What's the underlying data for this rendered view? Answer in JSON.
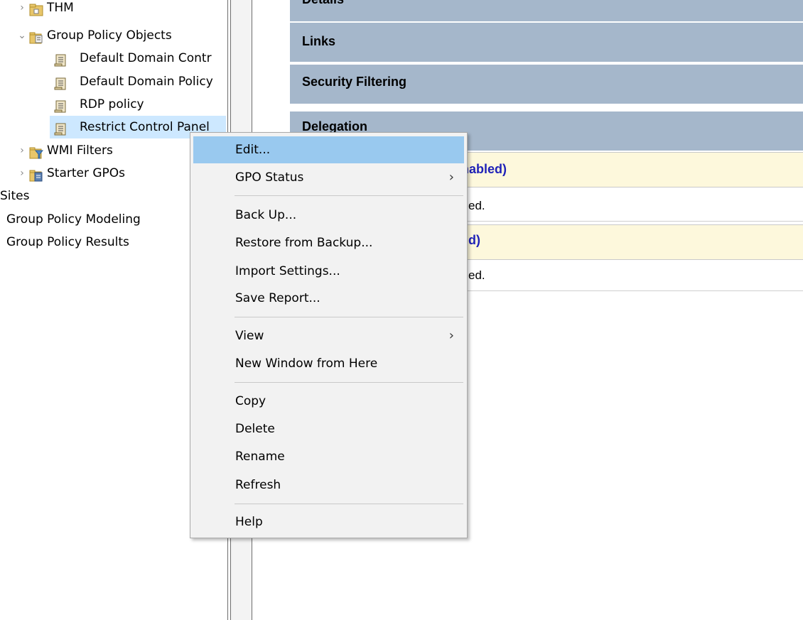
{
  "tree": {
    "items": [
      {
        "label": "THM",
        "chevron": "›",
        "icon": "ou-folder-icon"
      },
      {
        "label": "Group Policy Objects",
        "chevron": "⌄",
        "icon": "gpo-container-icon"
      },
      {
        "label": "Default Domain Contr",
        "icon": "gpo-scroll-icon"
      },
      {
        "label": "Default Domain Policy",
        "icon": "gpo-scroll-icon"
      },
      {
        "label": "RDP policy",
        "icon": "gpo-scroll-icon"
      },
      {
        "label": "Restrict Control Panel",
        "icon": "gpo-scroll-icon"
      },
      {
        "label": "WMI Filters",
        "chevron": "›",
        "icon": "wmi-filter-icon"
      },
      {
        "label": "Starter GPOs",
        "chevron": "›",
        "icon": "starter-gpo-icon"
      },
      {
        "label": "Sites"
      },
      {
        "label": "Group Policy Modeling"
      },
      {
        "label": "Group Policy Results"
      }
    ]
  },
  "report": {
    "sections": [
      "Details",
      "Links",
      "Security Filtering",
      "Delegation"
    ],
    "subsections": [
      {
        "heading": "nabled)",
        "text": "ed."
      },
      {
        "heading": "d)",
        "text": "ed."
      }
    ]
  },
  "context_menu": {
    "items": [
      {
        "label": "Edit...",
        "highlighted": true
      },
      {
        "label": "GPO Status",
        "submenu_arrow": "›"
      },
      {
        "label": "Back Up..."
      },
      {
        "label": "Restore from Backup..."
      },
      {
        "label": "Import Settings..."
      },
      {
        "label": "Save Report..."
      },
      {
        "label": "View",
        "submenu_arrow": "›"
      },
      {
        "label": "New Window from Here"
      },
      {
        "label": "Copy"
      },
      {
        "label": "Delete"
      },
      {
        "label": "Rename"
      },
      {
        "label": "Refresh"
      },
      {
        "label": "Help"
      }
    ]
  },
  "colors": {
    "section_header_bg": "#a5b7cb",
    "subsection_header_bg": "#fdf8dc",
    "subsection_header_text": "#1f22b8",
    "menu_highlight": "#99c9ef",
    "tree_selection": "#cde8ff"
  }
}
